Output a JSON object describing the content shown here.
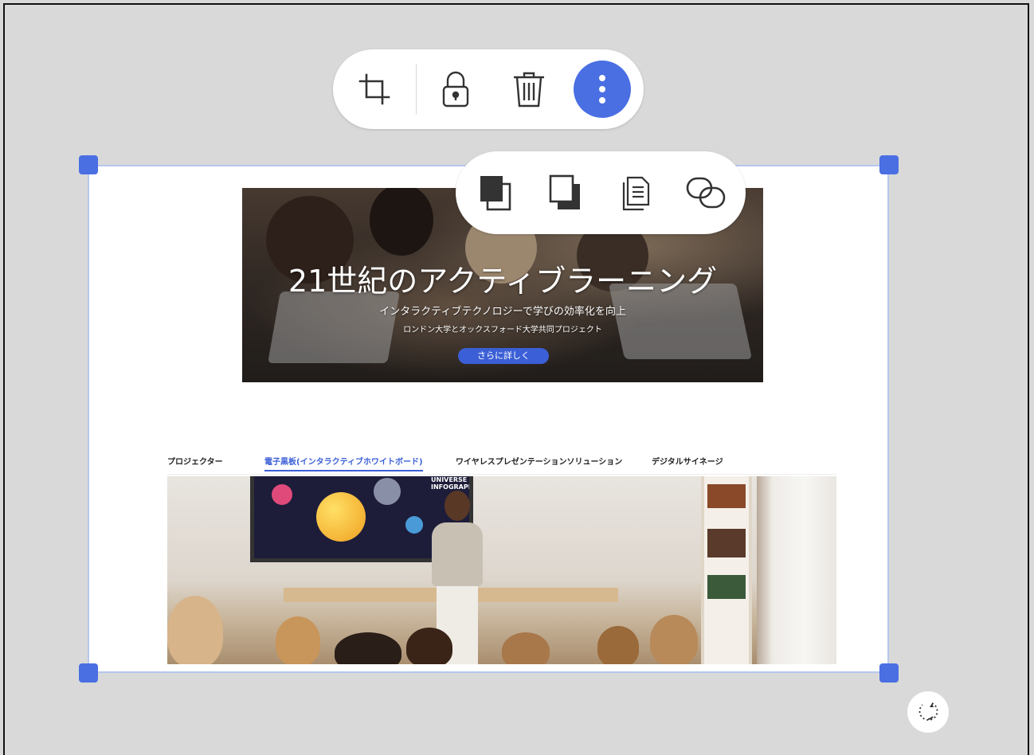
{
  "toolbar": {
    "icons": [
      "crop-icon",
      "lock-icon",
      "trash-icon",
      "more-vertical-icon"
    ],
    "accent_color": "#4a6fe3"
  },
  "arrange_menu": {
    "icons": [
      "bring-to-front-icon",
      "send-to-back-icon",
      "duplicate-icon",
      "link-icon"
    ]
  },
  "content": {
    "hero": {
      "title": "21世紀のアクティブラーニング",
      "subtitle": "インタラクティブテクノロジーで学びの効率化を向上",
      "caption": "ロンドン大学とオックスフォード大学共同プロジェクト",
      "cta": "さらに詳しく"
    },
    "tabs": [
      {
        "label": "プロジェクター",
        "active": false
      },
      {
        "label": "電子黒板(インタラクティブホワイトボード)",
        "active": true
      },
      {
        "label": "ワイヤレスプレゼンテーションソリューション",
        "active": false
      },
      {
        "label": "デジタルサイネージ",
        "active": false
      }
    ],
    "board_text": "UNIVERSE INFOGRAPHIC"
  },
  "canvas": {
    "rotate_icon": "rotate-icon",
    "background_color": "#d9d9d9",
    "selection_color": "#4a6fe3"
  }
}
